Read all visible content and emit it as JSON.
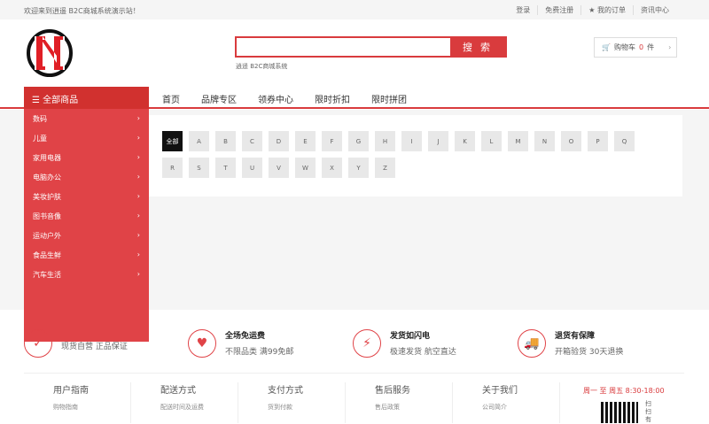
{
  "topbar": {
    "welcome": "欢迎来到逍遥 B2C商城系统演示站！",
    "links": [
      "登录",
      "免费注册",
      "★ 我的订单",
      "资讯中心"
    ]
  },
  "search": {
    "button": "搜 索",
    "placeholder": "",
    "hot": "逍遥  B2C商城系统"
  },
  "cart": {
    "label": "购物车",
    "count": "0",
    "unit": "件"
  },
  "nav": {
    "all": "全部商品",
    "items": [
      "首页",
      "品牌专区",
      "领券中心",
      "限时折扣",
      "限时拼团"
    ]
  },
  "categories": [
    "数码",
    "儿童",
    "家用电器",
    "电脑办公",
    "美妆护肤",
    "图书音像",
    "运动户外",
    "食品生鲜",
    "汽车生活"
  ],
  "letters": [
    "全部",
    "A",
    "B",
    "C",
    "D",
    "E",
    "F",
    "G",
    "H",
    "I",
    "J",
    "K",
    "L",
    "M",
    "N",
    "O",
    "P",
    "Q",
    "R",
    "S",
    "T",
    "U",
    "V",
    "W",
    "X",
    "Y",
    "Z"
  ],
  "services": [
    {
      "title": "",
      "desc": "现货自营 正品保证",
      "icon": "check-icon"
    },
    {
      "title": "全场免运费",
      "desc": "不限品类 满99免邮",
      "icon": "heart-hand-icon"
    },
    {
      "title": "发货如闪电",
      "desc": "极速发货 航空直达",
      "icon": "lightning-icon"
    },
    {
      "title": "退货有保障",
      "desc": "开箱验货 30天退换",
      "icon": "truck-icon"
    }
  ],
  "footer": {
    "columns": [
      {
        "title": "用户指南",
        "sub": "购物指南"
      },
      {
        "title": "配送方式",
        "sub": "配送时间及运费"
      },
      {
        "title": "支付方式",
        "sub": "货到付款"
      },
      {
        "title": "售后服务",
        "sub": "售后政策"
      },
      {
        "title": "关于我们",
        "sub": "公司简介"
      }
    ],
    "hours": "周一 至 周五   8:30-18:00",
    "scan": "扫扫有"
  },
  "colors": {
    "accent": "#d93b3d",
    "menu": "#e04347"
  }
}
